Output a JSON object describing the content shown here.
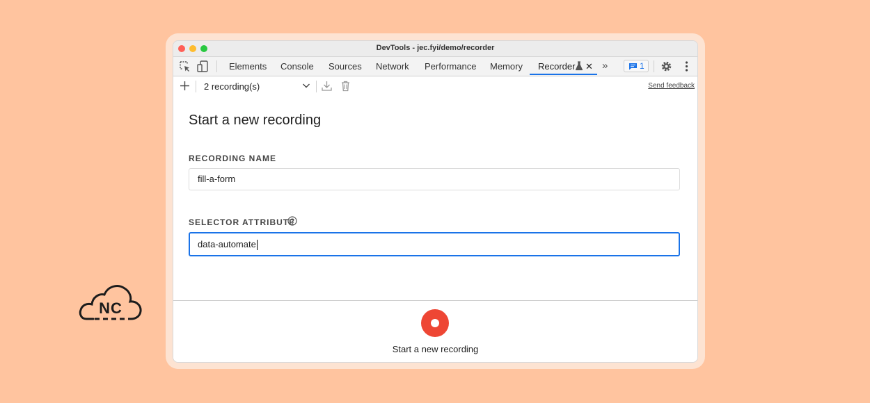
{
  "logo": {
    "text": "NC"
  },
  "window": {
    "title": "DevTools - jec.fyi/demo/recorder"
  },
  "tabs": [
    {
      "label": "Elements"
    },
    {
      "label": "Console"
    },
    {
      "label": "Sources"
    },
    {
      "label": "Network"
    },
    {
      "label": "Performance"
    },
    {
      "label": "Memory"
    },
    {
      "label": "Recorder",
      "active": true
    }
  ],
  "tabbar": {
    "inspect_icon": "inspect-element-icon",
    "device_icon": "device-toolbar-icon",
    "experiment_icon": "flask-icon",
    "close_label": "✕",
    "more_label": "»",
    "issues_count": "1",
    "settings_icon": "gear-icon",
    "menu_icon": "kebab-menu-icon"
  },
  "toolbar": {
    "add_icon": "plus-icon",
    "recordings_select": "2 recording(s)",
    "export_icon": "download-icon",
    "delete_icon": "trash-icon",
    "send_feedback": "Send feedback"
  },
  "form": {
    "heading": "Start a new recording",
    "recording_name_label": "RECORDING NAME",
    "recording_name_value": "fill-a-form",
    "selector_attribute_label": "SELECTOR ATTRIBUTE",
    "selector_attribute_value": "data-automate",
    "help_icon": "question-circle-icon"
  },
  "footer": {
    "record_label": "Start a new recording"
  },
  "colors": {
    "background": "#ffc49f",
    "accent": "#1a73e8",
    "record": "#ee4634"
  }
}
